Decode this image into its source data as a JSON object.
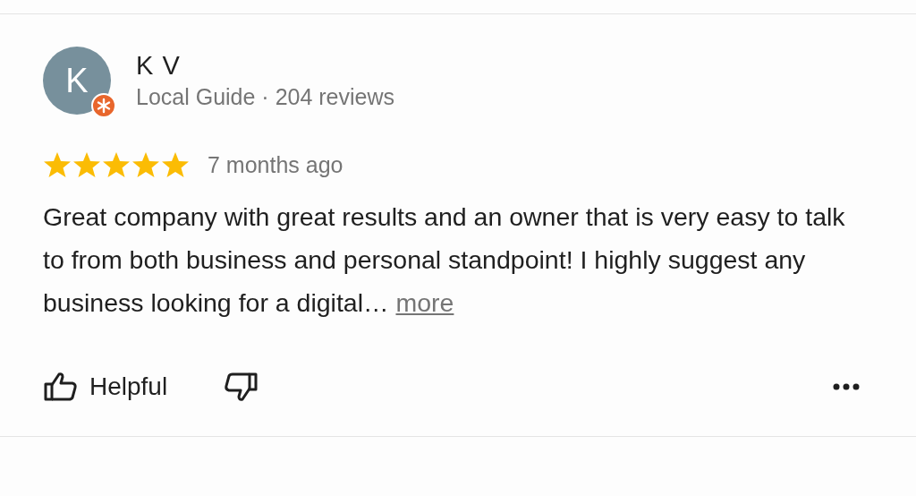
{
  "review": {
    "avatar_letter": "K",
    "local_guide": true,
    "name": "K V",
    "meta": "Local Guide · 204 reviews",
    "stars": 5,
    "time": "7 months ago",
    "text": "Great company with great results and an owner that is very easy to talk to from both business and personal standpoint! I highly suggest any business looking for a digital…",
    "more": "more",
    "helpful": "Helpful"
  }
}
